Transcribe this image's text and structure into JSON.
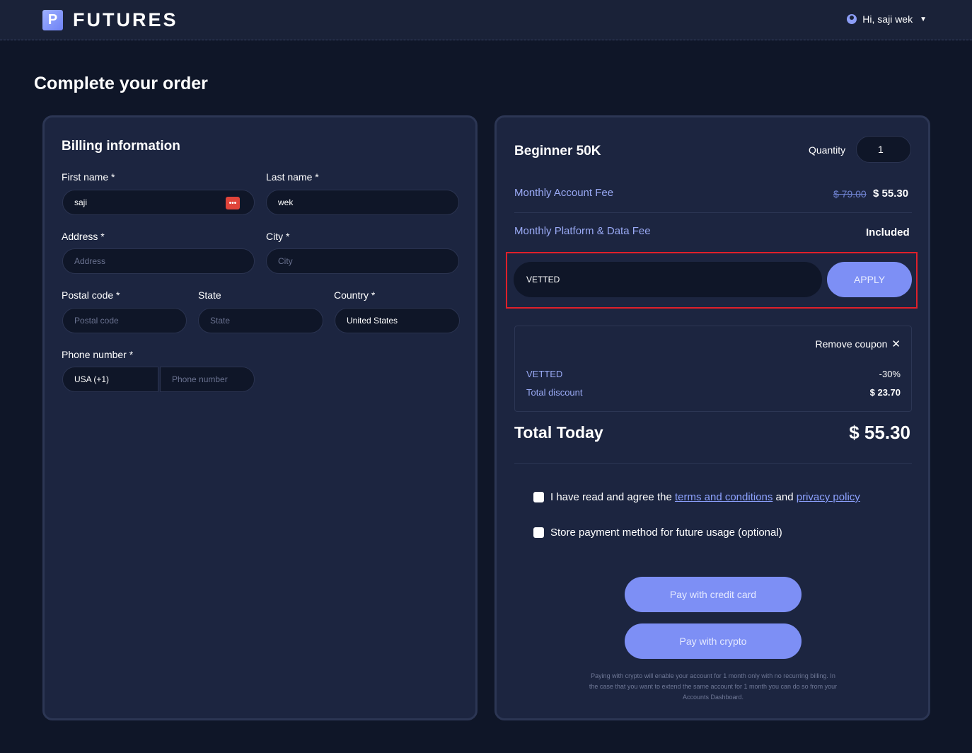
{
  "header": {
    "logo_mark": "P",
    "logo_text": "FUTURES",
    "user_greeting": "Hi, saji wek"
  },
  "page": {
    "title": "Complete your order"
  },
  "billing": {
    "title": "Billing information",
    "first_name": {
      "label": "First name *",
      "value": "saji"
    },
    "last_name": {
      "label": "Last name *",
      "value": "wek"
    },
    "address": {
      "label": "Address *",
      "placeholder": "Address"
    },
    "city": {
      "label": "City *",
      "placeholder": "City"
    },
    "postal_code": {
      "label": "Postal code *",
      "placeholder": "Postal code"
    },
    "state": {
      "label": "State",
      "placeholder": "State"
    },
    "country": {
      "label": "Country *",
      "value": "United States"
    },
    "phone": {
      "label": "Phone number *",
      "country_code": "USA (+1)",
      "placeholder": "Phone number"
    }
  },
  "order": {
    "plan_name": "Beginner 50K",
    "quantity_label": "Quantity",
    "quantity": "1",
    "monthly_account_fee": {
      "label": "Monthly Account Fee",
      "original": "$ 79.00",
      "price": "$ 55.30"
    },
    "platform_fee": {
      "label": "Monthly Platform & Data Fee",
      "value": "Included"
    },
    "coupon": {
      "value": "VETTED",
      "apply_label": "APPLY"
    },
    "discount": {
      "remove_label": "Remove coupon",
      "code": "VETTED",
      "percent": "-30%",
      "total_label": "Total discount",
      "total_value": "$ 23.70"
    },
    "total": {
      "label": "Total Today",
      "value": "$ 55.30"
    },
    "terms": {
      "prefix": "I have read and agree the",
      "terms_link": "terms and conditions",
      "and": "and",
      "privacy_link": "privacy policy"
    },
    "store_payment": "Store payment method for future usage (optional)",
    "pay_card_label": "Pay with credit card",
    "pay_crypto_label": "Pay with crypto",
    "crypto_note": "Paying with crypto will enable your account for 1 month only with no recurring billing. In the case that you want to extend the same account for 1 month you can do so from your Accounts Dashboard."
  },
  "colors": {
    "background": "#0f1628",
    "card": "#1c2540",
    "accent": "#7d8ff5",
    "highlight_border": "#e0202a"
  }
}
